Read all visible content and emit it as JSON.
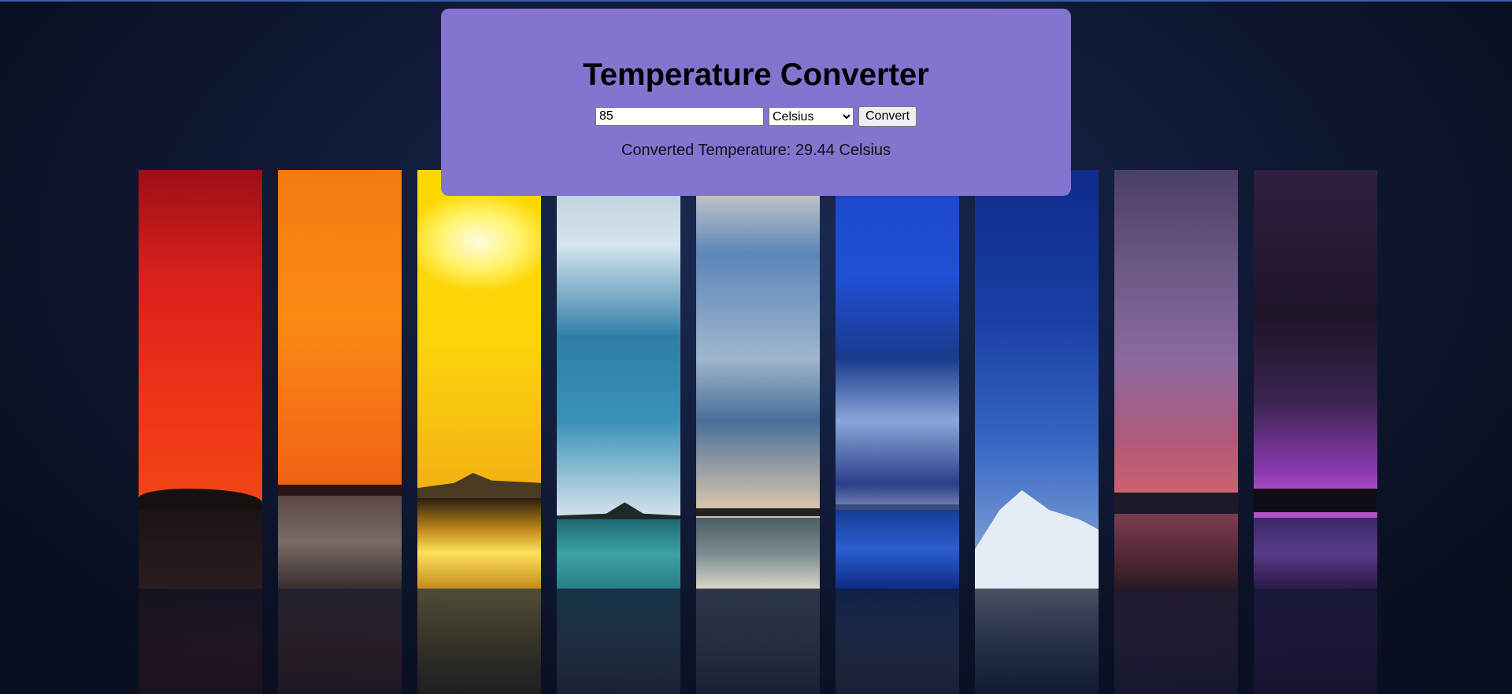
{
  "converter": {
    "title": "Temperature Converter",
    "input_value": "85",
    "unit_options": [
      "Celsius"
    ],
    "selected_unit": "Celsius",
    "convert_label": "Convert",
    "result_text": "Converted Temperature: 29.44 Celsius"
  },
  "background": {
    "description_panels": [
      "red-sunset",
      "orange-sunset",
      "yellow-sun",
      "cyan-clouds",
      "sky-clouds",
      "blue-clouds",
      "deep-blue-snow",
      "pink-dusk",
      "purple-night"
    ]
  },
  "colors": {
    "card": "#8474d0",
    "page_dark": "#0b1126"
  }
}
